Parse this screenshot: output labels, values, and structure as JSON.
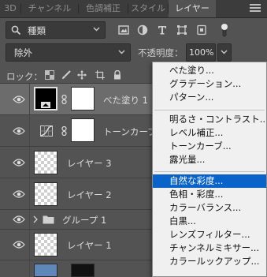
{
  "tabs": [
    {
      "label": "3D",
      "active": false
    },
    {
      "label": "チャンネル",
      "active": false
    },
    {
      "label": "色調補正",
      "active": false
    },
    {
      "label": "スタイル",
      "active": false
    },
    {
      "label": "レイヤー",
      "active": true
    }
  ],
  "filter": {
    "kind_label": "種類"
  },
  "blend": {
    "mode": "除外",
    "opacity_label": "不透明度：",
    "opacity_value": "100%"
  },
  "lock": {
    "label": "ロック："
  },
  "layers": [
    {
      "name": "べた塗り 1",
      "type": "fill",
      "selected": true
    },
    {
      "name": "トーンカーブ 1",
      "type": "adjustment",
      "selected": false
    },
    {
      "name": "レイヤー 3",
      "type": "pixel",
      "selected": false
    },
    {
      "name": "レイヤー 2",
      "type": "pixel",
      "selected": false
    },
    {
      "name": "グループ 1",
      "type": "group",
      "selected": false
    },
    {
      "name": "レイヤー 1",
      "type": "pixel",
      "selected": false
    }
  ],
  "dropdown": {
    "groups": [
      [
        "べた塗り...",
        "グラデーション...",
        "パターン..."
      ],
      [
        "明るさ・コントラスト...",
        "レベル補正...",
        "トーンカーブ...",
        "露光量..."
      ],
      [
        "自然な彩度...",
        "色相・彩度...",
        "カラーバランス...",
        "白黒...",
        "レンズフィルター...",
        "チャンネルミキサー...",
        "カラールックアップ..."
      ]
    ],
    "highlighted": "自然な彩度..."
  },
  "colors": {
    "panel_bg": "#535353",
    "selected_row": "#6c6c6c",
    "menu_bg": "#f0f0f0",
    "menu_highlight": "#0a63c9"
  }
}
